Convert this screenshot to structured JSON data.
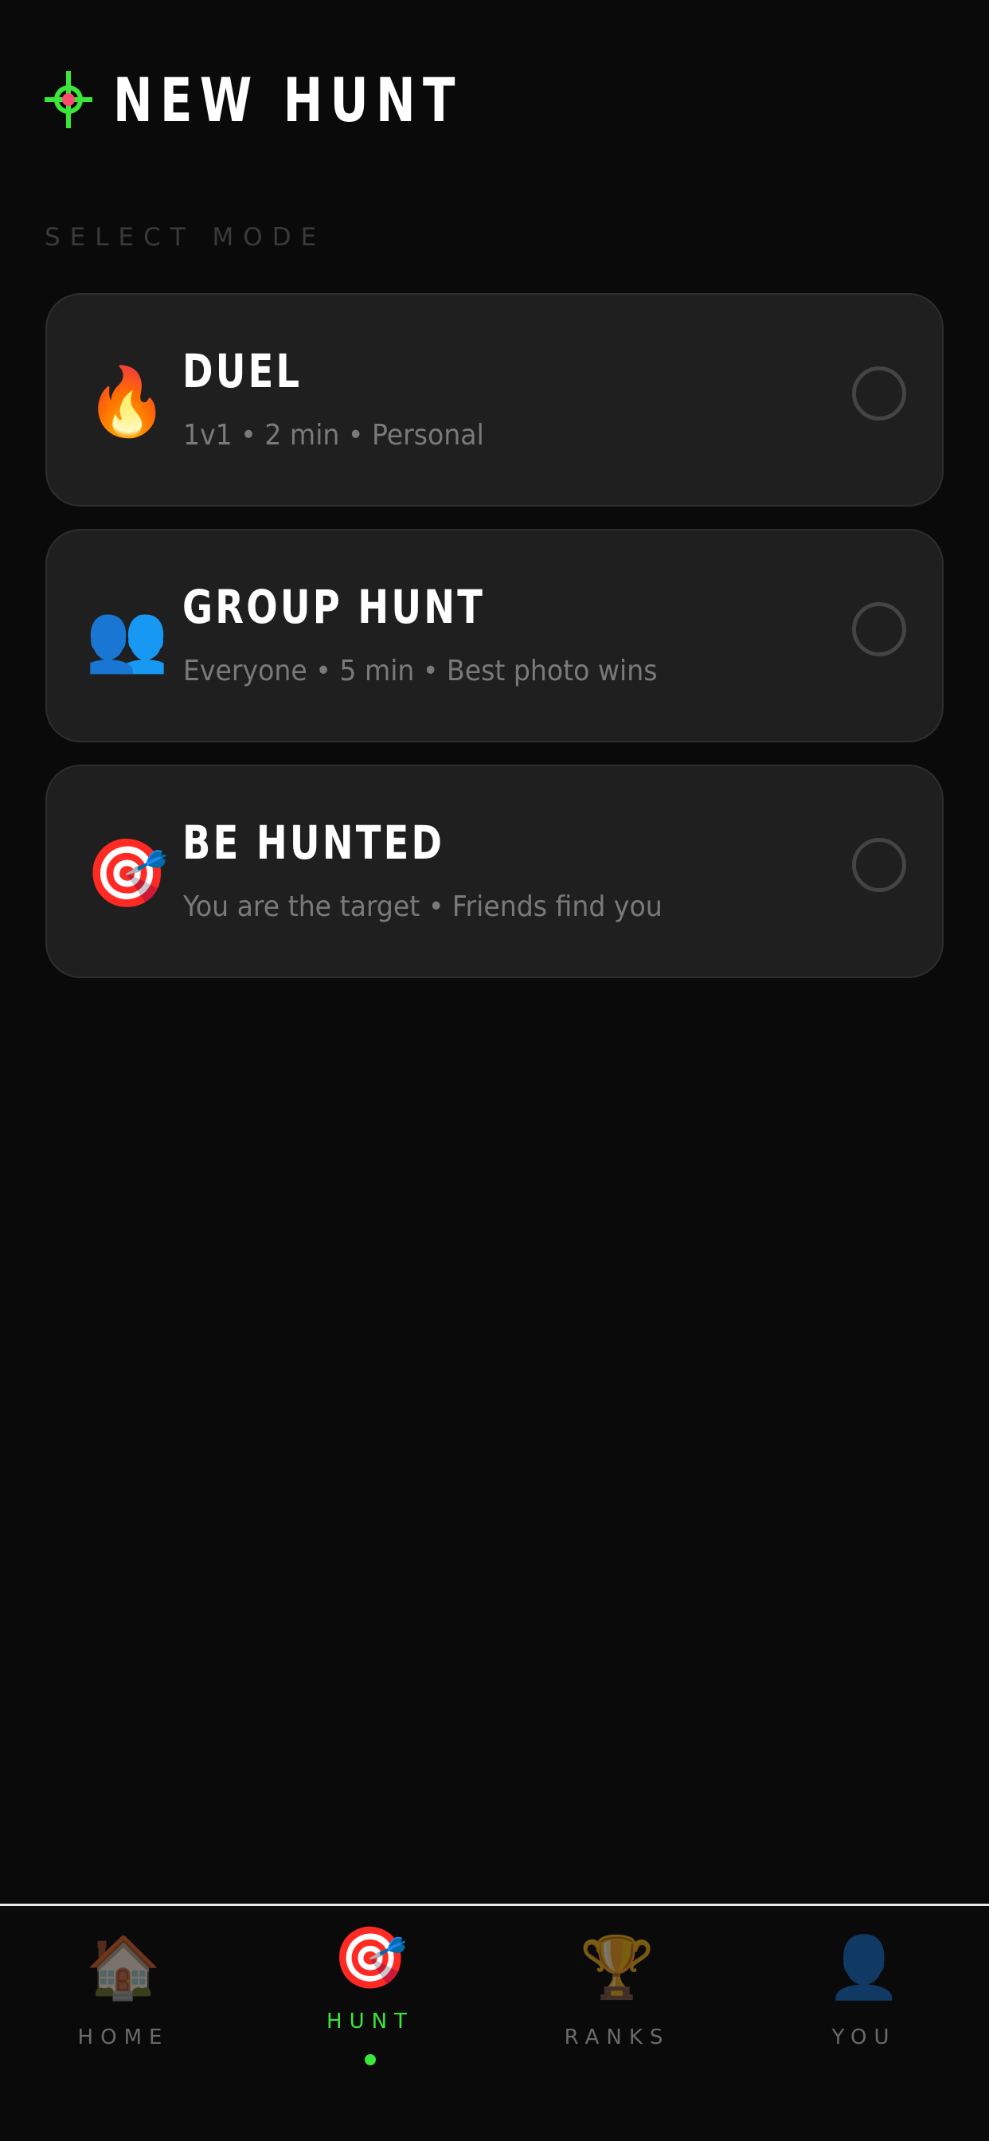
{
  "header": {
    "title": "NEW HUNT",
    "icon": "crosshair-icon",
    "accent_color": "#39e639"
  },
  "section": {
    "label": "SELECT MODE"
  },
  "modes": [
    {
      "name": "DUEL",
      "description": "1v1 • 2 min • Personal",
      "icon": "fire-icon",
      "glyph": "🔥",
      "selected": false
    },
    {
      "name": "GROUP HUNT",
      "description": "Everyone • 5 min • Best photo wins",
      "icon": "busts-icon",
      "glyph": "👥",
      "selected": false
    },
    {
      "name": "BE HUNTED",
      "description": "You are the target • Friends find you",
      "icon": "target-icon",
      "glyph": "🎯",
      "selected": false
    }
  ],
  "nav": {
    "active": "HUNT",
    "items": [
      {
        "label": "HOME",
        "icon": "house-icon",
        "glyph": "🏠"
      },
      {
        "label": "HUNT",
        "icon": "target-icon",
        "glyph": "🎯"
      },
      {
        "label": "RANKS",
        "icon": "trophy-icon",
        "glyph": "🏆"
      },
      {
        "label": "YOU",
        "icon": "user-icon",
        "glyph": "👤"
      }
    ]
  }
}
